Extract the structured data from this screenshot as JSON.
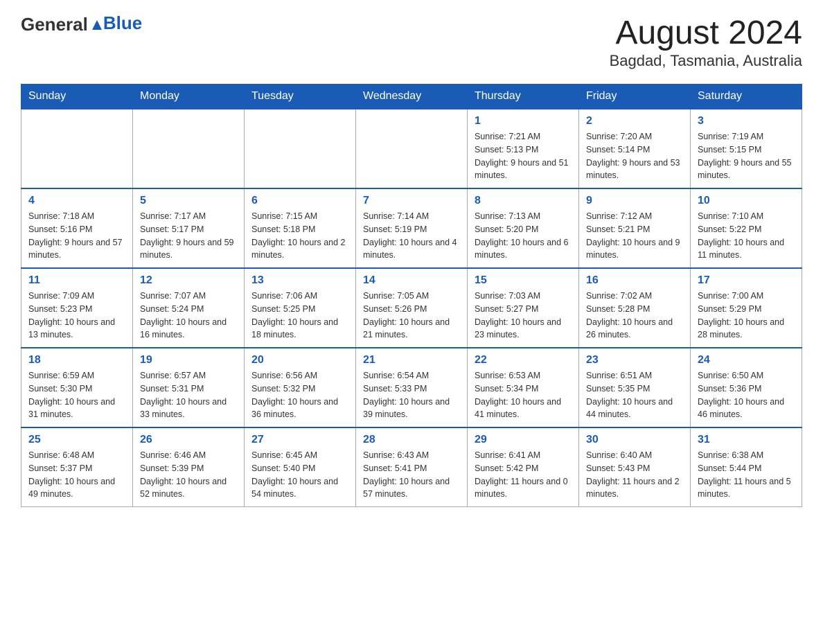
{
  "header": {
    "logo_text_general": "General",
    "logo_text_blue": "Blue",
    "month_title": "August 2024",
    "location": "Bagdad, Tasmania, Australia"
  },
  "days_of_week": [
    "Sunday",
    "Monday",
    "Tuesday",
    "Wednesday",
    "Thursday",
    "Friday",
    "Saturday"
  ],
  "weeks": [
    [
      {
        "day": "",
        "info": ""
      },
      {
        "day": "",
        "info": ""
      },
      {
        "day": "",
        "info": ""
      },
      {
        "day": "",
        "info": ""
      },
      {
        "day": "1",
        "info": "Sunrise: 7:21 AM\nSunset: 5:13 PM\nDaylight: 9 hours and 51 minutes."
      },
      {
        "day": "2",
        "info": "Sunrise: 7:20 AM\nSunset: 5:14 PM\nDaylight: 9 hours and 53 minutes."
      },
      {
        "day": "3",
        "info": "Sunrise: 7:19 AM\nSunset: 5:15 PM\nDaylight: 9 hours and 55 minutes."
      }
    ],
    [
      {
        "day": "4",
        "info": "Sunrise: 7:18 AM\nSunset: 5:16 PM\nDaylight: 9 hours and 57 minutes."
      },
      {
        "day": "5",
        "info": "Sunrise: 7:17 AM\nSunset: 5:17 PM\nDaylight: 9 hours and 59 minutes."
      },
      {
        "day": "6",
        "info": "Sunrise: 7:15 AM\nSunset: 5:18 PM\nDaylight: 10 hours and 2 minutes."
      },
      {
        "day": "7",
        "info": "Sunrise: 7:14 AM\nSunset: 5:19 PM\nDaylight: 10 hours and 4 minutes."
      },
      {
        "day": "8",
        "info": "Sunrise: 7:13 AM\nSunset: 5:20 PM\nDaylight: 10 hours and 6 minutes."
      },
      {
        "day": "9",
        "info": "Sunrise: 7:12 AM\nSunset: 5:21 PM\nDaylight: 10 hours and 9 minutes."
      },
      {
        "day": "10",
        "info": "Sunrise: 7:10 AM\nSunset: 5:22 PM\nDaylight: 10 hours and 11 minutes."
      }
    ],
    [
      {
        "day": "11",
        "info": "Sunrise: 7:09 AM\nSunset: 5:23 PM\nDaylight: 10 hours and 13 minutes."
      },
      {
        "day": "12",
        "info": "Sunrise: 7:07 AM\nSunset: 5:24 PM\nDaylight: 10 hours and 16 minutes."
      },
      {
        "day": "13",
        "info": "Sunrise: 7:06 AM\nSunset: 5:25 PM\nDaylight: 10 hours and 18 minutes."
      },
      {
        "day": "14",
        "info": "Sunrise: 7:05 AM\nSunset: 5:26 PM\nDaylight: 10 hours and 21 minutes."
      },
      {
        "day": "15",
        "info": "Sunrise: 7:03 AM\nSunset: 5:27 PM\nDaylight: 10 hours and 23 minutes."
      },
      {
        "day": "16",
        "info": "Sunrise: 7:02 AM\nSunset: 5:28 PM\nDaylight: 10 hours and 26 minutes."
      },
      {
        "day": "17",
        "info": "Sunrise: 7:00 AM\nSunset: 5:29 PM\nDaylight: 10 hours and 28 minutes."
      }
    ],
    [
      {
        "day": "18",
        "info": "Sunrise: 6:59 AM\nSunset: 5:30 PM\nDaylight: 10 hours and 31 minutes."
      },
      {
        "day": "19",
        "info": "Sunrise: 6:57 AM\nSunset: 5:31 PM\nDaylight: 10 hours and 33 minutes."
      },
      {
        "day": "20",
        "info": "Sunrise: 6:56 AM\nSunset: 5:32 PM\nDaylight: 10 hours and 36 minutes."
      },
      {
        "day": "21",
        "info": "Sunrise: 6:54 AM\nSunset: 5:33 PM\nDaylight: 10 hours and 39 minutes."
      },
      {
        "day": "22",
        "info": "Sunrise: 6:53 AM\nSunset: 5:34 PM\nDaylight: 10 hours and 41 minutes."
      },
      {
        "day": "23",
        "info": "Sunrise: 6:51 AM\nSunset: 5:35 PM\nDaylight: 10 hours and 44 minutes."
      },
      {
        "day": "24",
        "info": "Sunrise: 6:50 AM\nSunset: 5:36 PM\nDaylight: 10 hours and 46 minutes."
      }
    ],
    [
      {
        "day": "25",
        "info": "Sunrise: 6:48 AM\nSunset: 5:37 PM\nDaylight: 10 hours and 49 minutes."
      },
      {
        "day": "26",
        "info": "Sunrise: 6:46 AM\nSunset: 5:39 PM\nDaylight: 10 hours and 52 minutes."
      },
      {
        "day": "27",
        "info": "Sunrise: 6:45 AM\nSunset: 5:40 PM\nDaylight: 10 hours and 54 minutes."
      },
      {
        "day": "28",
        "info": "Sunrise: 6:43 AM\nSunset: 5:41 PM\nDaylight: 10 hours and 57 minutes."
      },
      {
        "day": "29",
        "info": "Sunrise: 6:41 AM\nSunset: 5:42 PM\nDaylight: 11 hours and 0 minutes."
      },
      {
        "day": "30",
        "info": "Sunrise: 6:40 AM\nSunset: 5:43 PM\nDaylight: 11 hours and 2 minutes."
      },
      {
        "day": "31",
        "info": "Sunrise: 6:38 AM\nSunset: 5:44 PM\nDaylight: 11 hours and 5 minutes."
      }
    ]
  ]
}
